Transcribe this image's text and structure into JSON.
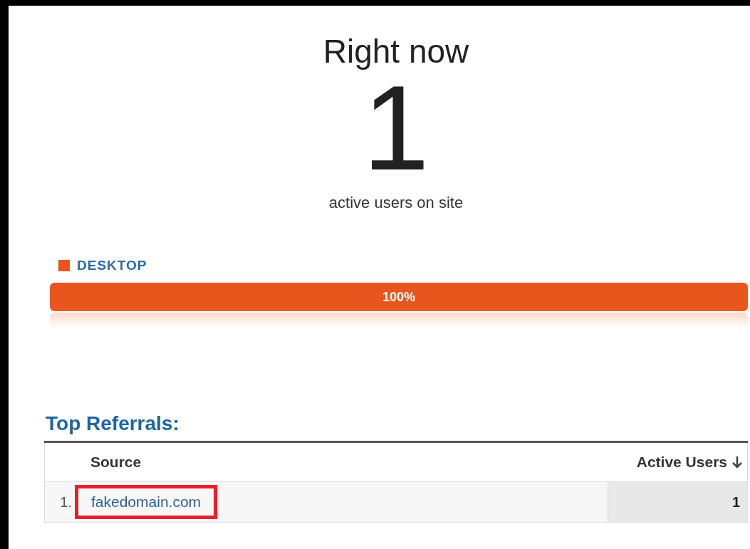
{
  "header": {
    "title": "Right now",
    "count": "1",
    "subtitle": "active users on site"
  },
  "devices": [
    {
      "label": "DESKTOP",
      "color": "#e8561e",
      "level": 1,
      "reading": "100%"
    }
  ],
  "referrals": {
    "title": "Top Referrals:",
    "columns": [
      {
        "label": "Source",
        "sorted": false
      },
      {
        "label": "Active Users",
        "sorted": true
      }
    ],
    "rows": [
      {
        "rank": "1.",
        "source": "fakedomain.com",
        "users": "1",
        "highlighted": true
      }
    ]
  }
}
